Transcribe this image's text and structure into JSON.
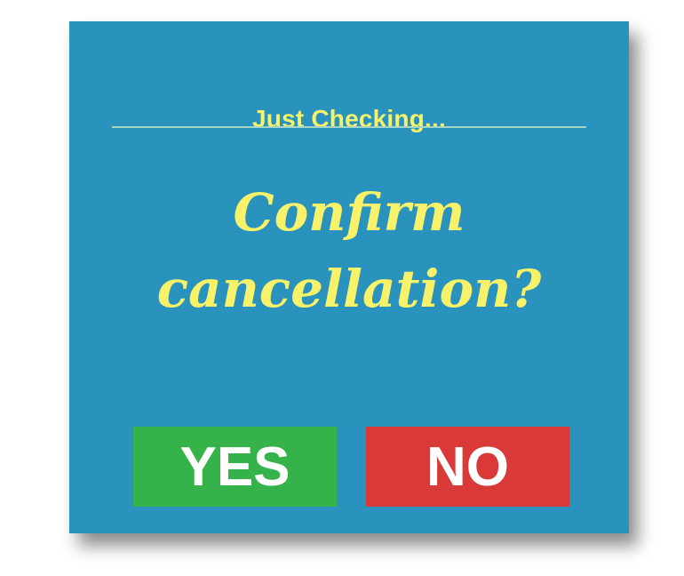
{
  "dialog": {
    "header": "Just Checking...",
    "message_line1": "Confirm",
    "message_line2": "cancellation?",
    "yes_label": "YES",
    "no_label": "NO"
  },
  "colors": {
    "dialog_background": "#2992bd",
    "accent_text": "#f7f26a",
    "divider": "#a4d4c6",
    "yes_button": "#36b24a",
    "no_button": "#d93a38",
    "button_text": "#ffffff"
  }
}
